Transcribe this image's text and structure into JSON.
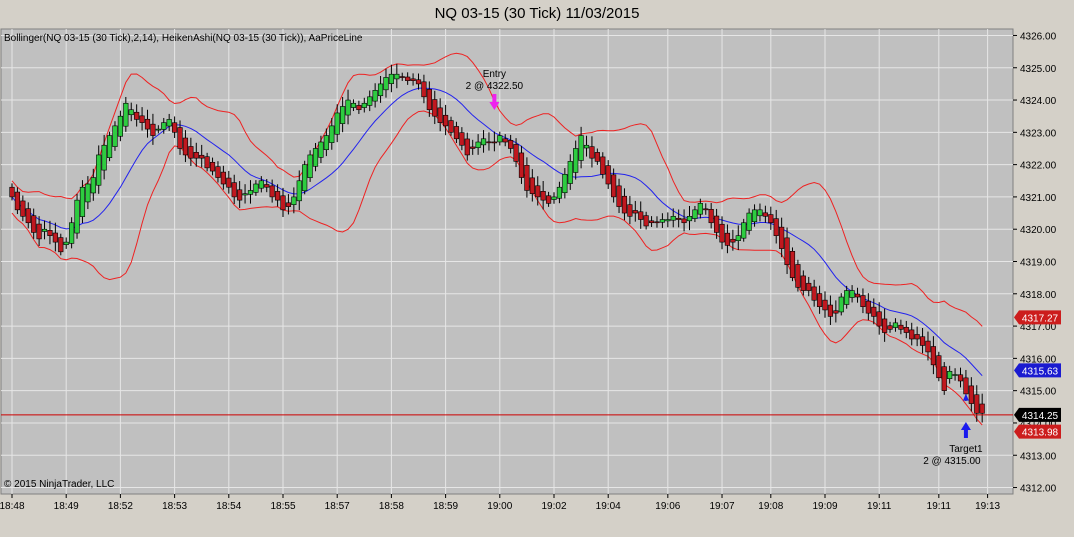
{
  "window": {
    "title": "NQ 03-15 (30 Tick)  11/03/2015"
  },
  "indicator_label": "Bollinger(NQ 03-15 (30 Tick),2,14), HeikenAshi(NQ 03-15 (30 Tick)), AaPriceLine",
  "copyright": "© 2015 NinjaTrader, LLC",
  "colors": {
    "bullish": "#2ecc40",
    "bearish": "#c0181f",
    "band": "#ee2222",
    "middle": "#2222ee",
    "price_line": "#cc0000",
    "entry": "#ee22ee",
    "target": "#1a1aee"
  },
  "price_tags": [
    {
      "label": "4317.27",
      "value": 4317.27,
      "bg": "#cc1d1d",
      "fg": "#ffffff"
    },
    {
      "label": "4315.63",
      "value": 4315.63,
      "bg": "#1a1ad0",
      "fg": "#ffffff"
    },
    {
      "label": "4314.25",
      "value": 4314.25,
      "bg": "#000000",
      "fg": "#ffffff"
    },
    {
      "label": "4313.98",
      "value": 4313.98,
      "bg": "#cc1d1d",
      "fg": "#ffffff"
    }
  ],
  "annotations": {
    "entry": {
      "line1": "Entry",
      "line2": "2 @ 4322.50",
      "price": 4322.5,
      "bar": 89
    },
    "target": {
      "line1": "Target1",
      "line2": "2 @ 4315.00",
      "price": 4315.0,
      "bar": 176
    }
  },
  "chart_data": {
    "type": "candlestick",
    "title": "NQ 03-15 (30 Tick)  11/03/2015",
    "ylim": [
      4311.8,
      4326.2
    ],
    "y_ticks": [
      "4312.00",
      "4313.00",
      "4314.00",
      "4315.00",
      "4316.00",
      "4317.00",
      "4318.00",
      "4319.00",
      "4320.00",
      "4321.00",
      "4322.00",
      "4323.00",
      "4324.00",
      "4325.00",
      "4326.00"
    ],
    "x_ticks": [
      {
        "label": "18:48",
        "bar": 0
      },
      {
        "label": "18:49",
        "bar": 10
      },
      {
        "label": "18:52",
        "bar": 20
      },
      {
        "label": "18:53",
        "bar": 30
      },
      {
        "label": "18:54",
        "bar": 40
      },
      {
        "label": "18:55",
        "bar": 50
      },
      {
        "label": "18:57",
        "bar": 60
      },
      {
        "label": "18:58",
        "bar": 70
      },
      {
        "label": "18:59",
        "bar": 80
      },
      {
        "label": "19:00",
        "bar": 90
      },
      {
        "label": "19:02",
        "bar": 100
      },
      {
        "label": "19:04",
        "bar": 110
      },
      {
        "label": "19:06",
        "bar": 121
      },
      {
        "label": "19:07",
        "bar": 131
      },
      {
        "label": "19:08",
        "bar": 140
      },
      {
        "label": "19:09",
        "bar": 150
      },
      {
        "label": "19:11",
        "bar": 160
      },
      {
        "label": "19:11",
        "bar": 171
      },
      {
        "label": "19:13",
        "bar": 180
      }
    ],
    "closes": [
      4321.0,
      4320.6,
      4320.4,
      4320.2,
      4319.9,
      4319.7,
      4320.0,
      4319.8,
      4319.6,
      4319.3,
      4319.6,
      4320.2,
      4320.9,
      4321.3,
      4321.4,
      4321.6,
      4322.3,
      4322.6,
      4322.9,
      4323.2,
      4323.5,
      4323.9,
      4323.7,
      4323.4,
      4323.3,
      4323.1,
      4322.9,
      4323.1,
      4323.3,
      4323.4,
      4323.0,
      4322.5,
      4322.3,
      4322.2,
      4322.2,
      4322.2,
      4321.9,
      4321.8,
      4321.6,
      4321.4,
      4321.3,
      4321.0,
      4320.9,
      4321.1,
      4321.2,
      4321.4,
      4321.5,
      4321.3,
      4321.0,
      4320.9,
      4320.6,
      4320.7,
      4321.0,
      4321.5,
      4322.0,
      4322.3,
      4322.5,
      4322.7,
      4322.9,
      4323.2,
      4323.6,
      4323.8,
      4324.0,
      4323.9,
      4323.7,
      4323.9,
      4324.1,
      4324.3,
      4324.5,
      4324.7,
      4324.8,
      4324.8,
      4324.7,
      4324.6,
      4324.6,
      4324.5,
      4324.1,
      4323.7,
      4323.5,
      4323.3,
      4323.2,
      4323.0,
      4322.8,
      4322.6,
      4322.3,
      4322.5,
      4322.7,
      4322.8,
      4322.7,
      4322.7,
      4322.9,
      4322.7,
      4322.5,
      4322.1,
      4321.6,
      4321.2,
      4321.1,
      4321.0,
      4320.9,
      4320.8,
      4321.0,
      4321.3,
      4321.7,
      4322.1,
      4322.5,
      4322.9,
      4322.6,
      4322.2,
      4322.1,
      4321.7,
      4321.4,
      4321.0,
      4320.7,
      4320.5,
      4320.4,
      4320.5,
      4320.3,
      4320.1,
      4320.2,
      4320.2,
      4320.3,
      4320.3,
      4320.4,
      4320.3,
      4320.2,
      4320.4,
      4320.6,
      4320.8,
      4320.6,
      4320.2,
      4319.9,
      4319.6,
      4319.5,
      4319.6,
      4319.8,
      4320.2,
      4320.5,
      4320.6,
      4320.6,
      4320.4,
      4320.2,
      4319.8,
      4319.4,
      4318.9,
      4318.5,
      4318.2,
      4318.1,
      4318.1,
      4317.8,
      4317.6,
      4317.5,
      4317.3,
      4317.4,
      4317.9,
      4318.1,
      4318.1,
      4317.9,
      4317.6,
      4317.4,
      4317.3,
      4317.0,
      4316.8,
      4316.9,
      4317.1,
      4316.9,
      4316.8,
      4316.6,
      4316.6,
      4316.4,
      4316.2,
      4315.8,
      4315.4,
      4315.0,
      4315.6,
      4315.5,
      4315.3,
      4314.9,
      4314.6,
      4314.3,
      4314.3
    ]
  }
}
